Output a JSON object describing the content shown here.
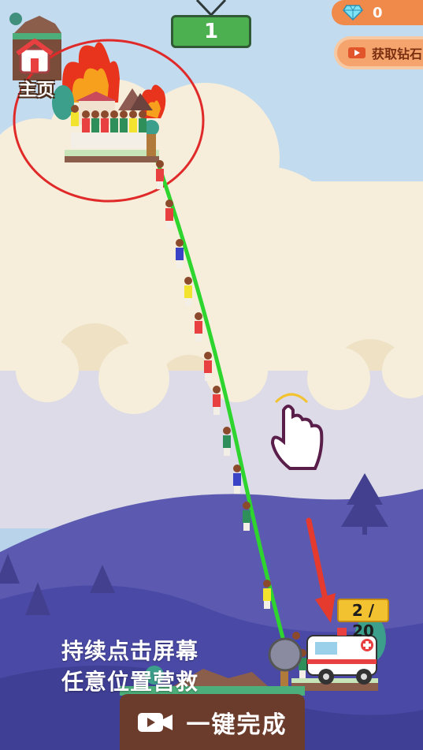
{
  "level": {
    "number": "1"
  },
  "hud": {
    "diamond_count": "0",
    "get_diamond_label": "获取钻石",
    "home_label": "主页"
  },
  "rescue": {
    "counter": "2 / 20"
  },
  "instruction": {
    "line1": "持续点击屏幕",
    "line2": "任意位置营救"
  },
  "finish": {
    "label": "一键完成"
  },
  "colors": {
    "sky": "#b9d3ea",
    "cloud": "#f6eedb",
    "hill_far": "#5b5ab0",
    "hill_near": "#4a4aa6",
    "rope": "#2ed52e",
    "level_green": "#4caf50",
    "pill_orange": "#f08a4b",
    "button_brown": "#6b3c2b"
  },
  "icons": [
    "diamond-icon",
    "video-camera-icon",
    "home-icon",
    "tap-hand-icon",
    "red-arrow-icon",
    "ambulance-icon",
    "fire-icon"
  ]
}
